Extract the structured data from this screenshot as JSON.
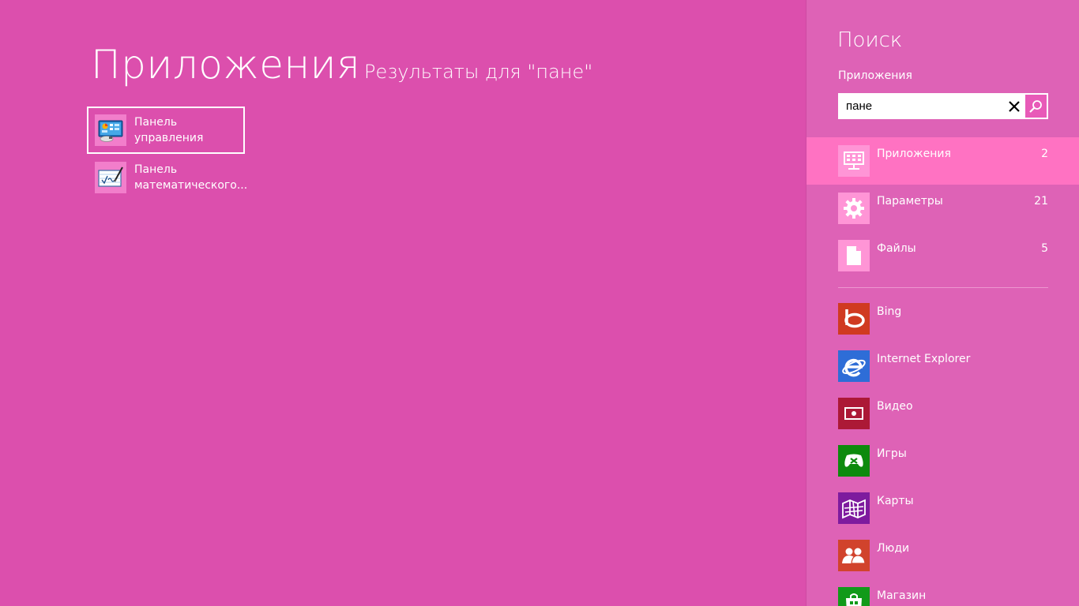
{
  "main": {
    "title": "Приложения",
    "subtitle": "Результаты для \"пане\"",
    "results": [
      {
        "label": "Панель управления",
        "icon": "control-panel-icon"
      },
      {
        "label": "Панель математического...",
        "icon": "math-input-panel-icon"
      }
    ]
  },
  "charm": {
    "title": "Поиск",
    "scope": "Приложения",
    "search": {
      "value": "пане"
    },
    "scopes": [
      {
        "name": "Приложения",
        "count": "2",
        "icon": "apps-icon"
      },
      {
        "name": "Параметры",
        "count": "21",
        "icon": "gear-icon"
      },
      {
        "name": "Файлы",
        "count": "5",
        "icon": "file-icon"
      }
    ],
    "apps": [
      {
        "name": "Bing",
        "icon": "bing-icon",
        "color": "#d03a21"
      },
      {
        "name": "Internet Explorer",
        "icon": "internet-explorer-icon",
        "color": "#2e6dd7"
      },
      {
        "name": "Видео",
        "icon": "video-icon",
        "color": "#ac1936"
      },
      {
        "name": "Игры",
        "icon": "games-icon",
        "color": "#0d8a0d"
      },
      {
        "name": "Карты",
        "icon": "maps-icon",
        "color": "#7e1b9e"
      },
      {
        "name": "Люди",
        "icon": "people-icon",
        "color": "#d1432c"
      },
      {
        "name": "Магазин",
        "icon": "store-icon",
        "color": "#119a19"
      }
    ]
  },
  "colors": {
    "background": "#dc4fad",
    "charm_background": "#de62b6",
    "active_scope": "#ff72c2"
  }
}
